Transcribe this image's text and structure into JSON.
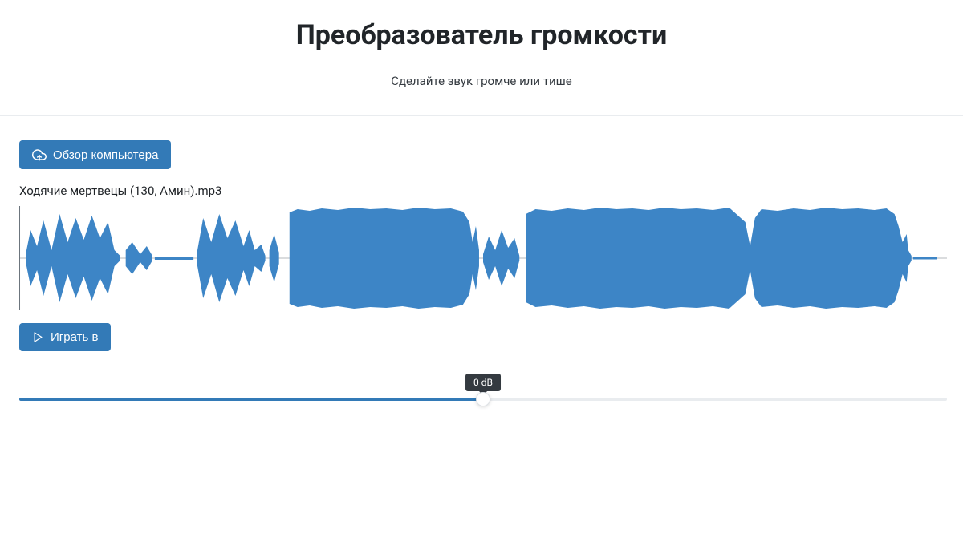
{
  "header": {
    "title": "Преобразователь громкости",
    "subtitle": "Сделайте звук громче или тише"
  },
  "browse": {
    "label": "Обзор компьютера"
  },
  "file": {
    "name": "Ходячие мертвецы (130, Амин).mp3"
  },
  "play": {
    "label": "Играть в"
  },
  "slider": {
    "value_label": "0 dB",
    "value_db": 0,
    "min_db": -60,
    "max_db": 60,
    "position_percent": 50
  },
  "colors": {
    "primary": "#337ab7",
    "waveform": "#3d85c6"
  }
}
